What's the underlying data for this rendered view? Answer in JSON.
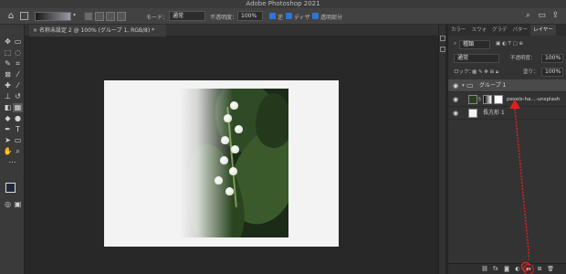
{
  "window": {
    "title": "Adobe Photoshop 2021"
  },
  "options_bar": {
    "mode_label": "モード：",
    "mode_value": "通常",
    "opacity_label": "不透明度：",
    "opacity_value": "100%",
    "reverse_label": "逆",
    "dither_label": "ディザ",
    "transparency_label": "透明部分"
  },
  "document": {
    "tab_label": "名称未設定 2 @ 100% (グループ 1, RGB/8) *",
    "close_glyph": "×"
  },
  "layers_panel": {
    "tabs": [
      {
        "label": "カラー"
      },
      {
        "label": "スウォ"
      },
      {
        "label": "グラデ"
      },
      {
        "label": "パター"
      },
      {
        "label": "レイヤー"
      }
    ],
    "kind_filter": "種類",
    "blend_mode": "通常",
    "opacity_label": "不透明度：",
    "opacity_value": "100%",
    "lock_label": "ロック：",
    "fill_label": "塗り：",
    "fill_value": "100%",
    "layers": [
      {
        "name": "グループ 1",
        "type": "group",
        "visible": true,
        "selected": true
      },
      {
        "name": "pexels-ha...-unsplash",
        "type": "smart-with-mask",
        "visible": true,
        "selected": false
      },
      {
        "name": "長方形 1",
        "type": "shape",
        "visible": true,
        "selected": false
      }
    ]
  },
  "colors": {
    "foreground": "#1e2a3a",
    "background": "#ffffff",
    "accent": "#2d74da",
    "annotation": "#e02020"
  },
  "icons": {
    "home": "home-icon",
    "search": "search-icon",
    "workspace": "workspace-icon",
    "share": "share-icon",
    "eye": "eye-icon",
    "folder": "folder-icon",
    "new_group": "new-group-icon"
  }
}
